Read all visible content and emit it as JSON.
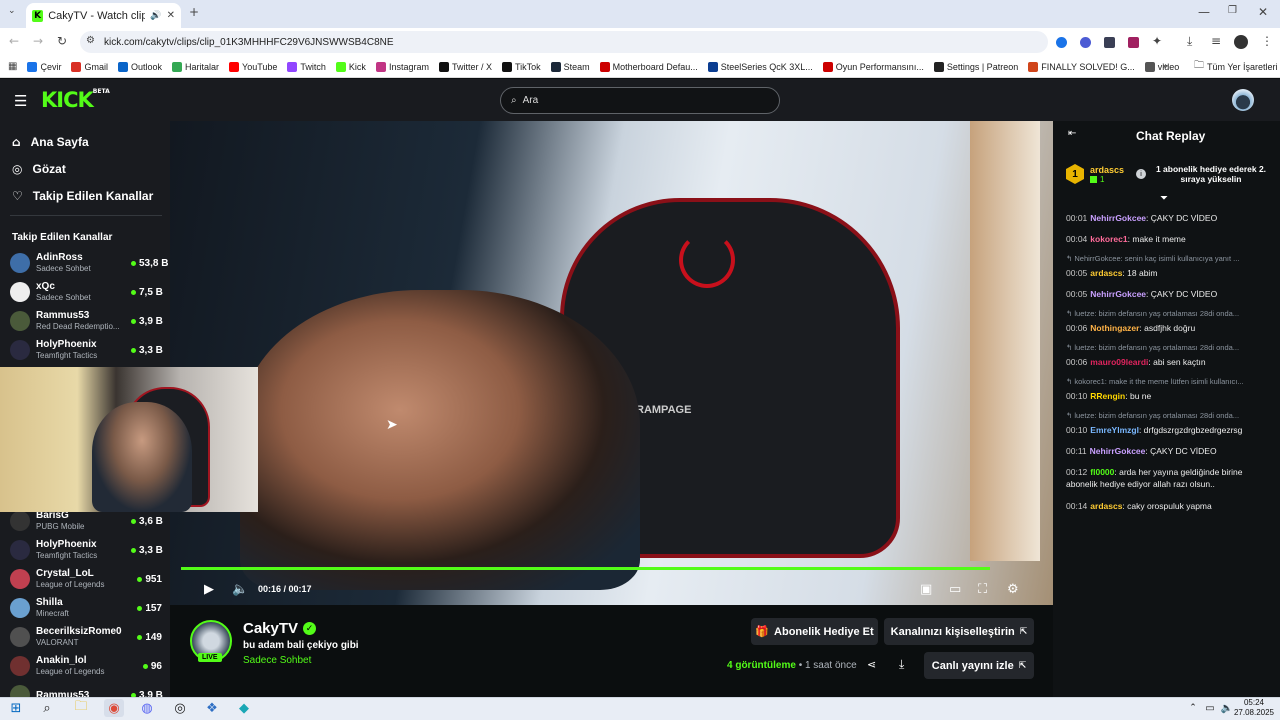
{
  "browser": {
    "tab_title": "CakyTV - Watch clips on Ki",
    "url": "kick.com/cakytv/clips/clip_01K3MHHHFC29V6JNSWWSB4C8NE",
    "bookmarks": [
      "Çevir",
      "Gmail",
      "Outlook",
      "Haritalar",
      "YouTube",
      "Twitch",
      "Kick",
      "Instagram",
      "Twitter / X",
      "TikTok",
      "Steam",
      "Motherboard Defau...",
      "SteelSeries QcK 3XL...",
      "Oyun Performansını...",
      "Settings | Patreon",
      "FINALLY SOLVED! G...",
      "video"
    ],
    "bookmarks_all": "Tüm Yer İşaretleri"
  },
  "header": {
    "logo": "KICK",
    "beta": "BETA",
    "search_placeholder": "Ara"
  },
  "sidebar": {
    "nav": [
      {
        "label": "Ana Sayfa",
        "icon": "home-icon"
      },
      {
        "label": "Gözat",
        "icon": "compass-icon"
      },
      {
        "label": "Takip Edilen Kanallar",
        "icon": "heart-icon"
      }
    ],
    "followed_title": "Takip Edilen Kanallar",
    "channels_top": [
      {
        "name": "AdinRoss",
        "cat": "Sadece Sohbet",
        "viewers": "53,8 B",
        "color": "#3e6ea8"
      },
      {
        "name": "xQc",
        "cat": "Sadece Sohbet",
        "viewers": "7,5 B",
        "color": "#eeeeee"
      },
      {
        "name": "Rammus53",
        "cat": "Red Dead Redemptio...",
        "viewers": "3,9 B",
        "color": "#4a5a3a"
      },
      {
        "name": "HolyPhoenix",
        "cat": "Teamfight Tactics",
        "viewers": "3,3 B",
        "color": "#2a2a40"
      }
    ],
    "channels_bottom": [
      {
        "name": "BarisG",
        "cat": "PUBG Mobile",
        "viewers": "3,6 B",
        "color": "#333"
      },
      {
        "name": "HolyPhoenix",
        "cat": "Teamfight Tactics",
        "viewers": "3,3 B",
        "color": "#2a2a40"
      },
      {
        "name": "Crystal_LoL",
        "cat": "League of Legends",
        "viewers": "951",
        "color": "#c04050"
      },
      {
        "name": "Shilla",
        "cat": "Minecraft",
        "viewers": "157",
        "color": "#6aa0d0"
      },
      {
        "name": "BecerilksizRome0",
        "cat": "VALORANT",
        "viewers": "149",
        "color": "#505050"
      },
      {
        "name": "Anakin_lol",
        "cat": "League of Legends",
        "viewers": "96",
        "color": "#703030"
      },
      {
        "name": "Rammus53",
        "cat": "",
        "viewers": "3,9 B",
        "color": "#4a5a3a"
      }
    ]
  },
  "player": {
    "time": "00:16 / 00:17",
    "progress": 0.94
  },
  "clip": {
    "channel": "CakyTV",
    "title": "bu adam bali çekiyo gibi",
    "category": "Sadece Sohbet",
    "live": "LIVE",
    "views_count": "4",
    "views_label": "görüntüleme",
    "age": "• 1 saat önce",
    "gift_button": "Abonelik Hediye Et",
    "customize_button": "Kanalınızı kişiselleştirin",
    "watch_live_button": "Canlı yayını izle"
  },
  "chat": {
    "title": "Chat Replay",
    "leader_name": "ardascs",
    "leader_rank": "1",
    "leader_count": "1",
    "leader_msg": "1 abonelik hediye ederek 2. sıraya yükselin",
    "messages": [
      {
        "t": "00:01",
        "user": "NehirrGokcee",
        "color": "#c9a0ff",
        "text": "ÇAKY DC VİDEO",
        "reply": ""
      },
      {
        "t": "00:04",
        "user": "kokorec1",
        "color": "#ff6b9a",
        "text": "make it meme",
        "reply": ""
      },
      {
        "t": "00:05",
        "user": "ardascs",
        "color": "#ffcc33",
        "text": "18 abim",
        "reply": "NehirrGokcee: senin kaç isimli kullanıcıya yanıt ..."
      },
      {
        "t": "00:05",
        "user": "NehirrGokcee",
        "color": "#c9a0ff",
        "text": "ÇAKY DC VİDEO",
        "reply": ""
      },
      {
        "t": "00:06",
        "user": "Nothingazer",
        "color": "#ffb347",
        "text": "asdfjhk doğru",
        "reply": "luetze: bizim defansın yaş ortalaması 28di onda..."
      },
      {
        "t": "00:06",
        "user": "mauro09leardi",
        "color": "#e0245e",
        "text": "abi sen kaçtın",
        "reply": "luetze: bizim defansın yaş ortalaması 28di onda..."
      },
      {
        "t": "00:10",
        "user": "RRengin",
        "color": "#ffd700",
        "text": "bu ne",
        "reply": "kokorec1: make it the meme lütfen isimli kullanıcı..."
      },
      {
        "t": "00:10",
        "user": "EmreYlmzgl",
        "color": "#7ab8ff",
        "text": "drfgdszrgzdrgbzedrgezrsg",
        "reply": "luetze: bizim defansın yaş ortalaması 28di onda..."
      },
      {
        "t": "00:11",
        "user": "NehirrGokcee",
        "color": "#c9a0ff",
        "text": "ÇAKY DC VİDEO",
        "reply": ""
      },
      {
        "t": "00:12",
        "user": "fl0000",
        "color": "#53fc18",
        "text": "arda her yayına geldiğinde birine abonelik hediye ediyor allah razı olsun..",
        "reply": ""
      },
      {
        "t": "00:14",
        "user": "ardascs",
        "color": "#ffcc33",
        "text": "caky orospuluk yapma",
        "reply": ""
      }
    ]
  },
  "taskbar": {
    "time": "05:24",
    "date": "27.08.2025"
  }
}
